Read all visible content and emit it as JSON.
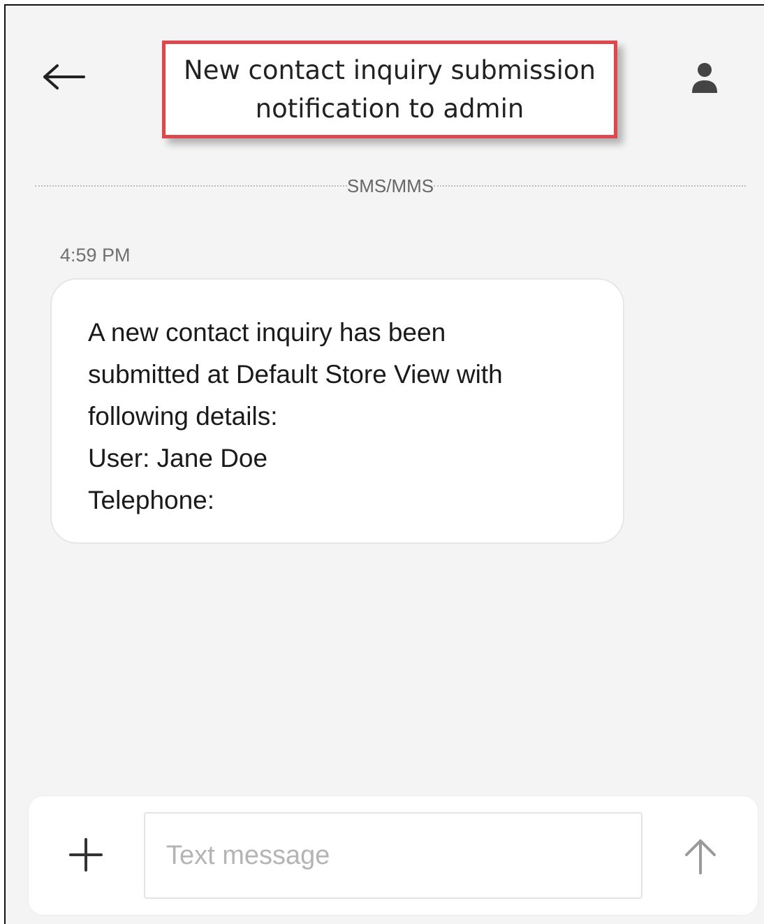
{
  "header": {
    "title_line1": "New contact inquiry submission",
    "title_line2": "notification to admin",
    "back_icon": "arrow-left-icon",
    "contact_icon": "person-icon"
  },
  "conversation": {
    "channel_label": "SMS/MMS",
    "messages": [
      {
        "time": "4:59 PM",
        "lines": [
          "A new contact inquiry has been",
          "submitted at Default Store View with",
          "following details:",
          "User: Jane Doe",
          "Telephone:"
        ]
      }
    ]
  },
  "composer": {
    "placeholder": "Text message",
    "add_icon": "plus-icon",
    "send_icon": "arrow-up-icon"
  },
  "colors": {
    "callout_border": "#e0474c",
    "background": "#f4f4f4",
    "bubble": "#ffffff"
  }
}
